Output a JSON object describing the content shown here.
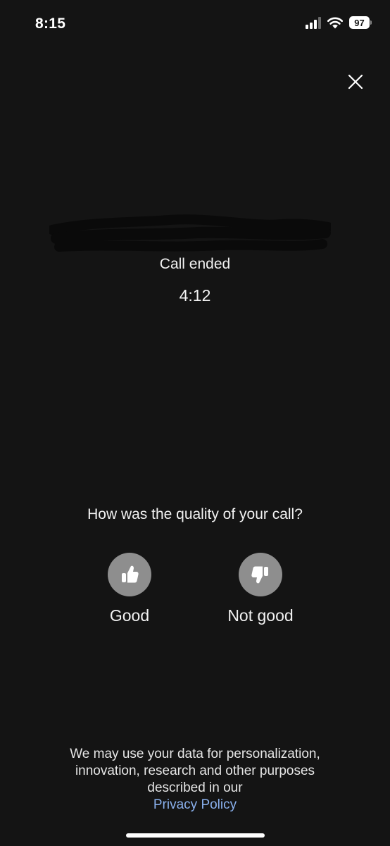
{
  "status_bar": {
    "time": "8:15",
    "battery_level": "97",
    "signal_icon": "signal-bars-icon",
    "wifi_icon": "wifi-icon",
    "battery_icon": "battery-icon"
  },
  "header": {
    "close_icon": "close-icon"
  },
  "call": {
    "status": "Call ended",
    "duration": "4:12"
  },
  "feedback": {
    "question": "How was the quality of your call?",
    "good_label": "Good",
    "good_icon": "thumbs-up-icon",
    "bad_label": "Not good",
    "bad_icon": "thumbs-down-icon"
  },
  "disclaimer": {
    "line1": "We may use your data for personalization,",
    "line2": "innovation, research and other purposes",
    "line3": "described in our",
    "link_label": "Privacy Policy"
  },
  "colors": {
    "background": "#141414",
    "rating_circle": "#8e8e8e",
    "link": "#8ab1ee"
  }
}
